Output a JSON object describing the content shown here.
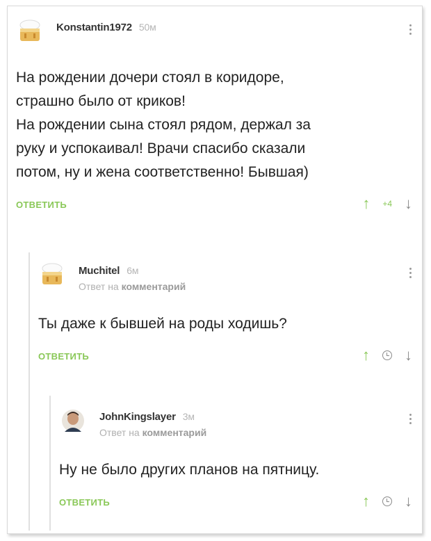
{
  "comments": [
    {
      "author": "Konstantin1972",
      "time": "50м",
      "text": "На рождении дочери стоял в коридоре,\nстрашно было от криков!\nНа рождении сына стоял рядом, держал за\nруку и успокаивал! Врачи спасибо сказали\nпотом, ну и жена соответственно! Бывшая)",
      "reply_label": "ОТВЕТИТЬ",
      "rating": "+4",
      "avatar_icon": "chef-cake-avatar-icon"
    },
    {
      "author": "Muchitel",
      "time": "6м",
      "reply_prefix": "Ответ на",
      "reply_target": "комментарий",
      "text": "Ты даже к бывшей на роды ходишь?",
      "reply_label": "ОТВЕТИТЬ",
      "avatar_icon": "chef-cake-avatar-icon"
    },
    {
      "author": "JohnKingslayer",
      "time": "3м",
      "reply_prefix": "Ответ на",
      "reply_target": "комментарий",
      "text": "Ну не было других планов на пятницу.",
      "reply_label": "ОТВЕТИТЬ",
      "avatar_icon": "user-photo-avatar-icon"
    }
  ],
  "colors": {
    "accent": "#8ac858",
    "muted": "#b0b0b0"
  }
}
